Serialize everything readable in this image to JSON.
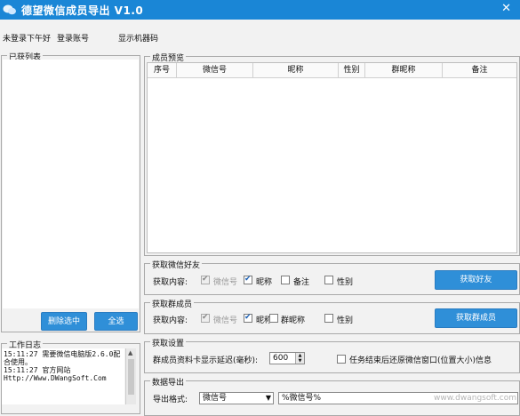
{
  "window": {
    "title": "德望微信成员导出 V1.0",
    "close_glyph": "✕"
  },
  "status_row": {
    "login_status": "未登录",
    "greeting": "下午好",
    "login_account": "登录账号",
    "show_machine_code": "显示机器码"
  },
  "left_panel": {
    "list_title": "已获列表",
    "delete_selected": "删除选中",
    "select_all": "全选"
  },
  "log_panel": {
    "title": "工作日志",
    "lines": [
      "15:11:27  需要微信电脑版2.6.0配",
      "合使用。",
      "15:11:27  官方网站",
      "Http://Www.DWangSoft.Com"
    ]
  },
  "member_preview": {
    "title": "成员预览",
    "columns": [
      "序号",
      "微信号",
      "昵称",
      "性别",
      "群昵称",
      "备注"
    ]
  },
  "friends_group": {
    "title": "获取微信好友",
    "content_label": "获取内容:",
    "options": [
      {
        "label": "微信号",
        "checked": true,
        "disabled": true
      },
      {
        "label": "昵称",
        "checked": true,
        "disabled": false
      },
      {
        "label": "备注",
        "checked": false,
        "disabled": false
      },
      {
        "label": "性别",
        "checked": false,
        "disabled": false
      }
    ],
    "button": "获取好友"
  },
  "group_members": {
    "title": "获取群成员",
    "content_label": "获取内容:",
    "options": [
      {
        "label": "微信号",
        "checked": true,
        "disabled": true
      },
      {
        "label": "昵称",
        "checked": true,
        "disabled": false
      },
      {
        "label": "群昵称",
        "checked": false,
        "disabled": false
      },
      {
        "label": "性别",
        "checked": false,
        "disabled": false
      }
    ],
    "button": "获取群成员"
  },
  "settings": {
    "title": "获取设置",
    "delay_label": "群成员资料卡显示延迟(毫秒):",
    "delay_value": "600",
    "restore_label": "任务结束后还原微信窗口(位置大小)信息",
    "restore_checked": false
  },
  "export": {
    "title": "数据导出",
    "format_label": "导出格式:",
    "format_selected": "微信号",
    "format_template": "%微信号%"
  },
  "watermark": "www.dwangsoft.com",
  "colors": {
    "titlebar": "#1a86d6",
    "button": "#2f8fd8"
  }
}
